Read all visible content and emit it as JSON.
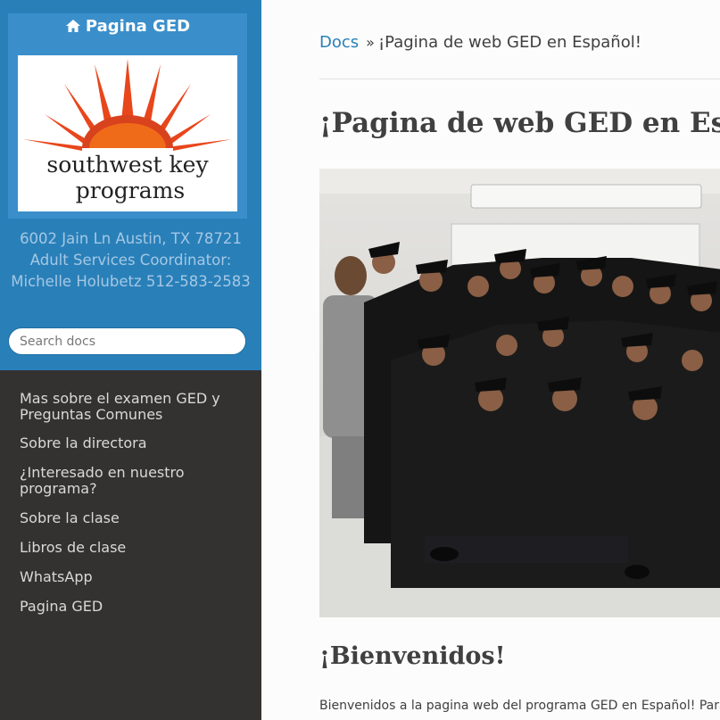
{
  "sidebar": {
    "brand": "Pagina GED",
    "logo": {
      "line1": "southwest key",
      "line2": "programs"
    },
    "address": "6002 Jain Ln Austin, TX 78721 Adult Services Coordinator: Michelle Holubetz 512-583-2583",
    "search_placeholder": "Search docs",
    "nav": [
      "Mas sobre el examen GED y Preguntas Comunes",
      "Sobre la directora",
      "¿Interesado en nuestro programa?",
      "Sobre la clase",
      "Libros de clase",
      "WhatsApp",
      "Pagina GED"
    ]
  },
  "main": {
    "breadcrumb": {
      "root": "Docs",
      "separator": "»",
      "current": "¡Pagina de web GED en Español!"
    },
    "title": "¡Pagina de web GED en Español!",
    "section_title": "¡Bienvenidos!",
    "paragraph": "Bienvenidos a la pagina web del programa GED en Español! Para"
  },
  "colors": {
    "accent": "#2980b9",
    "sidebar_bg": "#343131",
    "logo_sun": "#e8461b"
  }
}
